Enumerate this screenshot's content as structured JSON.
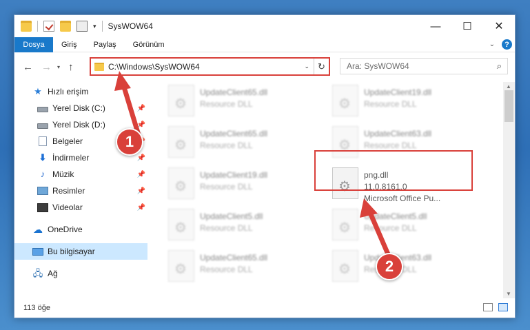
{
  "window": {
    "title": "SysWOW64"
  },
  "ribbon": {
    "tabs": [
      "Dosya",
      "Giriş",
      "Paylaş",
      "Görünüm"
    ]
  },
  "navigation": {
    "address_path": "C:\\Windows\\SysWOW64",
    "search_placeholder": "Ara: SysWOW64"
  },
  "sidebar": {
    "items": [
      {
        "label": "Hızlı erişim",
        "icon": "star-icon",
        "pinned": false
      },
      {
        "label": "Yerel Disk (C:)",
        "icon": "drive-icon",
        "pinned": true
      },
      {
        "label": "Yerel Disk (D:)",
        "icon": "drive-icon",
        "pinned": true
      },
      {
        "label": "Belgeler",
        "icon": "documents-icon",
        "pinned": true
      },
      {
        "label": "İndirmeler",
        "icon": "downloads-icon",
        "pinned": true
      },
      {
        "label": "Müzik",
        "icon": "music-icon",
        "pinned": true
      },
      {
        "label": "Resimler",
        "icon": "pictures-icon",
        "pinned": true
      },
      {
        "label": "Videolar",
        "icon": "videos-icon",
        "pinned": true
      },
      {
        "label": "OneDrive",
        "icon": "onedrive-icon",
        "pinned": false
      },
      {
        "label": "Bu bilgisayar",
        "icon": "computer-icon",
        "pinned": false,
        "selected": true
      },
      {
        "label": "Ağ",
        "icon": "network-icon",
        "pinned": false
      }
    ]
  },
  "files": [
    {
      "name": "UpdateClient65.dll",
      "type": "Resource DLL",
      "blurred": true
    },
    {
      "name": "UpdateClient19.dll",
      "type": "Resource DLL",
      "blurred": true
    },
    {
      "name": "UpdateClient65.dll",
      "type": "Resource DLL",
      "blurred": true
    },
    {
      "name": "UpdateClient63.dll",
      "type": "Resource DLL",
      "blurred": true
    },
    {
      "name": "UpdateClient19.dll",
      "type": "Resource DLL",
      "blurred": true
    },
    {
      "name": "png.dll",
      "version": "11.0.8161.0",
      "company": "Microsoft Office Pu...",
      "blurred": false
    },
    {
      "name": "UpdateClient5.dll",
      "type": "Resource DLL",
      "blurred": true
    },
    {
      "name": "UpdateClient5.dll",
      "type": "Resource DLL",
      "blurred": true
    },
    {
      "name": "UpdateClient65.dll",
      "type": "Resource DLL",
      "blurred": true
    },
    {
      "name": "UpdateClient63.dll",
      "type": "Resource DLL",
      "blurred": true
    }
  ],
  "status": {
    "item_count": "113 öğe"
  },
  "annotations": {
    "badge1": "1",
    "badge2": "2",
    "color": "#d9403a"
  }
}
